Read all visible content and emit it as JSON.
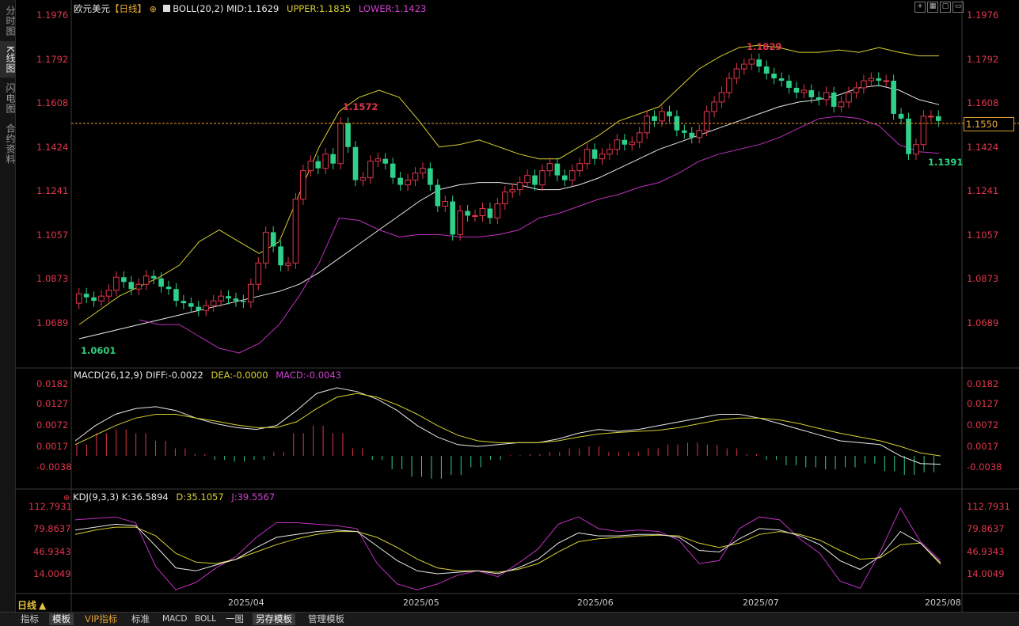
{
  "sidebar": {
    "items": [
      {
        "label": "分时图",
        "active": false
      },
      {
        "label": "K线图",
        "active": true
      },
      {
        "label": "闪电图",
        "active": false
      },
      {
        "label": "合约资料",
        "active": false
      }
    ]
  },
  "main_header": {
    "symbol": "欧元美元",
    "period": "【日线】",
    "boll_label": "BOLL(20,2)",
    "mid": "MID:1.1629",
    "upper": "UPPER:1.1835",
    "lower": "LOWER:1.1423"
  },
  "macd_header": {
    "label": "MACD(26,12,9)",
    "diff": "DIFF:-0.0022",
    "dea": "DEA:-0.0000",
    "macd": "MACD:-0.0043"
  },
  "kdj_header": {
    "label": "KDJ(9,3,3)",
    "k": "K:36.5894",
    "d": "D:35.1057",
    "j": "J:39.5567"
  },
  "price_axis": [
    "1.1976",
    "1.1792",
    "1.1608",
    "1.1424",
    "1.1241",
    "1.1057",
    "1.0873",
    "1.0689"
  ],
  "macd_axis": [
    "0.0182",
    "0.0127",
    "0.0072",
    "0.0017",
    "-0.0038"
  ],
  "kdj_axis": [
    "112.7931",
    "79.8637",
    "46.9343",
    "14.0049"
  ],
  "x_axis": [
    "2025/04",
    "2025/05",
    "2025/06",
    "2025/07",
    "2025/08"
  ],
  "current_price": "1.1550",
  "annotations": {
    "low_start": "1.0601",
    "peak_may": "1.1572",
    "peak_july": "1.1829",
    "low_recent": "1.1391"
  },
  "period_selector": "日线",
  "bottom_tabs": [
    {
      "label": "指标",
      "active": false,
      "vip": false
    },
    {
      "label": "模板",
      "active": true,
      "vip": false
    },
    {
      "label": "VIP指标",
      "active": false,
      "vip": true
    },
    {
      "label": "标准",
      "active": false,
      "vip": false
    },
    {
      "label": "MACD",
      "active": false,
      "vip": false
    },
    {
      "label": "BOLL",
      "active": false,
      "vip": false
    },
    {
      "label": "一图",
      "active": false,
      "vip": false
    },
    {
      "label": "另存模板",
      "active": true,
      "vip": false
    },
    {
      "label": "管理模板",
      "active": false,
      "vip": false
    }
  ],
  "colors": {
    "up": "#e0364a",
    "down": "#2fd08a",
    "mid_line": "#e8e8e8",
    "upper_line": "#d8d030",
    "lower_line": "#c030c0",
    "dea_line": "#d8d030",
    "price_line": "#f0a030"
  },
  "chart_data": {
    "type": "candlestick",
    "price_range": [
      1.06,
      1.1976
    ],
    "open": [
      1.079,
      1.083,
      1.0815,
      1.08,
      1.082,
      1.0845,
      1.09,
      1.088,
      1.085,
      1.087,
      1.0905,
      1.0895,
      1.086,
      1.085,
      1.08,
      1.079,
      1.0775,
      1.076,
      1.078,
      1.08,
      1.082,
      1.081,
      1.08,
      1.0795,
      1.087,
      1.096,
      1.109,
      1.103,
      1.095,
      1.096,
      1.123,
      1.135,
      1.139,
      1.136,
      1.142,
      1.138,
      1.155,
      1.145,
      1.131,
      1.132,
      1.139,
      1.14,
      1.138,
      1.132,
      1.129,
      1.131,
      1.134,
      1.136,
      1.129,
      1.12,
      1.122,
      1.108,
      1.118,
      1.116,
      1.116,
      1.119,
      1.115,
      1.121,
      1.126,
      1.127,
      1.13,
      1.133,
      1.129,
      1.135,
      1.138,
      1.133,
      1.131,
      1.135,
      1.138,
      1.144,
      1.14,
      1.142,
      1.144,
      1.148,
      1.146,
      1.147,
      1.151,
      1.158,
      1.156,
      1.16,
      1.158,
      1.152,
      1.151,
      1.149,
      1.152,
      1.16,
      1.164,
      1.168,
      1.174,
      1.178,
      1.18,
      1.182,
      1.179,
      1.176,
      1.174,
      1.173,
      1.17,
      1.168,
      1.169,
      1.166,
      1.165,
      1.168,
      1.162,
      1.164,
      1.168,
      1.17,
      1.173,
      1.174,
      1.173,
      1.173,
      1.159,
      1.157,
      1.142,
      1.146,
      1.158,
      1.158
    ],
    "close": [
      1.083,
      1.0815,
      1.08,
      1.082,
      1.0845,
      1.09,
      1.088,
      1.085,
      1.087,
      1.0905,
      1.0895,
      1.086,
      1.085,
      1.08,
      1.079,
      1.0775,
      1.076,
      1.078,
      1.08,
      1.082,
      1.081,
      1.08,
      1.0795,
      1.087,
      1.096,
      1.109,
      1.103,
      1.095,
      1.096,
      1.123,
      1.135,
      1.139,
      1.136,
      1.142,
      1.138,
      1.155,
      1.145,
      1.131,
      1.132,
      1.139,
      1.14,
      1.138,
      1.132,
      1.129,
      1.131,
      1.134,
      1.136,
      1.129,
      1.12,
      1.122,
      1.108,
      1.118,
      1.116,
      1.116,
      1.119,
      1.115,
      1.121,
      1.126,
      1.127,
      1.13,
      1.133,
      1.129,
      1.135,
      1.138,
      1.133,
      1.131,
      1.135,
      1.138,
      1.144,
      1.14,
      1.142,
      1.144,
      1.148,
      1.146,
      1.147,
      1.151,
      1.158,
      1.156,
      1.16,
      1.158,
      1.152,
      1.151,
      1.149,
      1.152,
      1.16,
      1.164,
      1.168,
      1.174,
      1.178,
      1.18,
      1.182,
      1.179,
      1.176,
      1.174,
      1.173,
      1.17,
      1.168,
      1.169,
      1.166,
      1.165,
      1.168,
      1.162,
      1.164,
      1.168,
      1.17,
      1.173,
      1.174,
      1.173,
      1.173,
      1.159,
      1.157,
      1.142,
      1.146,
      1.158,
      1.158,
      1.156
    ],
    "boll_mid": [
      1.064,
      1.066,
      1.068,
      1.07,
      1.072,
      1.074,
      1.076,
      1.078,
      1.08,
      1.082,
      1.084,
      1.087,
      1.092,
      1.098,
      1.104,
      1.11,
      1.116,
      1.122,
      1.127,
      1.129,
      1.13,
      1.13,
      1.129,
      1.127,
      1.127,
      1.129,
      1.132,
      1.136,
      1.14,
      1.144,
      1.147,
      1.15,
      1.153,
      1.156,
      1.159,
      1.162,
      1.164,
      1.165,
      1.167,
      1.17,
      1.171,
      1.169,
      1.165,
      1.1629
    ],
    "boll_upper": [
      1.07,
      1.076,
      1.082,
      1.086,
      1.09,
      1.095,
      1.105,
      1.11,
      1.105,
      1.1,
      1.105,
      1.125,
      1.145,
      1.16,
      1.166,
      1.169,
      1.166,
      1.156,
      1.145,
      1.146,
      1.148,
      1.145,
      1.142,
      1.14,
      1.14,
      1.145,
      1.15,
      1.156,
      1.159,
      1.162,
      1.17,
      1.178,
      1.183,
      1.187,
      1.188,
      1.187,
      1.185,
      1.185,
      1.186,
      1.185,
      1.187,
      1.185,
      1.1835,
      1.1835
    ],
    "boll_lower": [
      null,
      null,
      null,
      1.072,
      1.07,
      1.07,
      1.065,
      1.06,
      1.058,
      1.062,
      1.07,
      1.082,
      1.096,
      1.115,
      1.114,
      1.11,
      1.107,
      1.108,
      1.108,
      1.107,
      1.107,
      1.108,
      1.11,
      1.115,
      1.117,
      1.12,
      1.123,
      1.125,
      1.128,
      1.13,
      1.134,
      1.139,
      1.142,
      1.144,
      1.146,
      1.149,
      1.153,
      1.157,
      1.158,
      1.157,
      1.154,
      1.146,
      1.143,
      1.1423
    ],
    "macd_range": [
      -0.0075,
      0.0205
    ],
    "diff": [
      0.004,
      0.008,
      0.011,
      0.0125,
      0.013,
      0.012,
      0.01,
      0.0085,
      0.0075,
      0.007,
      0.008,
      0.012,
      0.0165,
      0.018,
      0.017,
      0.015,
      0.012,
      0.008,
      0.005,
      0.003,
      0.0025,
      0.003,
      0.0035,
      0.0035,
      0.0045,
      0.006,
      0.007,
      0.0065,
      0.007,
      0.008,
      0.009,
      0.01,
      0.011,
      0.011,
      0.01,
      0.0085,
      0.007,
      0.0055,
      0.004,
      0.0035,
      0.003,
      0.0,
      -0.002,
      -0.0022
    ],
    "dea": [
      0.003,
      0.0055,
      0.008,
      0.01,
      0.011,
      0.011,
      0.01,
      0.0092,
      0.0082,
      0.0075,
      0.0075,
      0.009,
      0.0125,
      0.0155,
      0.0165,
      0.0155,
      0.0135,
      0.011,
      0.008,
      0.0055,
      0.004,
      0.0035,
      0.0035,
      0.0035,
      0.004,
      0.005,
      0.0058,
      0.0062,
      0.0065,
      0.0068,
      0.0075,
      0.0085,
      0.0095,
      0.01,
      0.01,
      0.0095,
      0.0085,
      0.0072,
      0.006,
      0.005,
      0.004,
      0.0025,
      0.0008,
      0.0
    ],
    "macd_hist": [
      0.003,
      0.006,
      0.007,
      0.006,
      0.004,
      0.002,
      0.0005,
      -0.001,
      -0.0015,
      -0.001,
      0.001,
      0.006,
      0.008,
      0.006,
      0.002,
      -0.001,
      -0.0035,
      -0.0055,
      -0.006,
      -0.005,
      -0.003,
      -0.001,
      0.0002,
      0.0005,
      0.001,
      0.002,
      0.0025,
      0.001,
      0.001,
      0.002,
      0.003,
      0.0035,
      0.003,
      0.002,
      0.0005,
      -0.001,
      -0.0025,
      -0.003,
      -0.0035,
      -0.003,
      -0.002,
      -0.004,
      -0.005,
      -0.0043
    ],
    "kdj_range": [
      -3,
      123
    ],
    "k": [
      82,
      86,
      90,
      88,
      60,
      30,
      26,
      34,
      42,
      58,
      72,
      76,
      80,
      82,
      80,
      60,
      40,
      26,
      22,
      24,
      26,
      22,
      30,
      42,
      64,
      78,
      74,
      74,
      76,
      76,
      72,
      54,
      52,
      70,
      84,
      82,
      74,
      62,
      40,
      28,
      46,
      80,
      64,
      37
    ],
    "d": [
      76,
      82,
      86,
      86,
      74,
      50,
      38,
      36,
      42,
      52,
      62,
      70,
      76,
      80,
      80,
      72,
      58,
      42,
      30,
      26,
      26,
      24,
      28,
      36,
      52,
      66,
      70,
      72,
      74,
      75,
      74,
      64,
      58,
      64,
      76,
      80,
      76,
      68,
      54,
      42,
      44,
      62,
      64,
      35
    ],
    "j": [
      96,
      98,
      100,
      92,
      32,
      0,
      10,
      30,
      46,
      72,
      92,
      92,
      90,
      88,
      84,
      36,
      8,
      0,
      8,
      20,
      26,
      18,
      36,
      56,
      90,
      100,
      84,
      80,
      82,
      80,
      68,
      36,
      40,
      84,
      100,
      96,
      70,
      50,
      12,
      2,
      52,
      112,
      66,
      40
    ]
  }
}
